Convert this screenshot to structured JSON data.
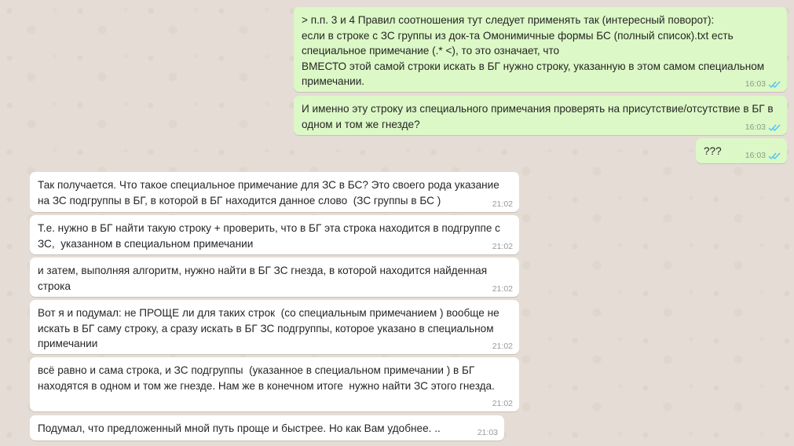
{
  "colors": {
    "background": "#e5ddd5",
    "outgoing_bubble": "#dcf8c6",
    "incoming_bubble": "#ffffff",
    "read_ticks": "#4fc3f7"
  },
  "messages": [
    {
      "direction": "out",
      "text": "> п.п. 3 и 4 Правил соотношения тут следует применять так (интересный поворот):\nесли в строке с ЗС группы из док-та Омонимичные формы БС (полный список).txt есть специальное примечание (.* <), то это означает, что\nВМЕСТО этой самой строки искать в БГ нужно строку, указанную в этом самом специальном примечании.",
      "time": "16:03",
      "status_icon": "double-check-read-icon"
    },
    {
      "direction": "out",
      "text": "И именно эту строку из специального примечания проверять на присутствие/отсутствие в БГ в одном и том же гнезде?",
      "time": "16:03",
      "status_icon": "double-check-read-icon"
    },
    {
      "direction": "out",
      "text": "???",
      "time": "16:03",
      "status_icon": "double-check-read-icon"
    },
    {
      "direction": "in",
      "text": "Так получается. Что такое специальное примечание для ЗС в БС? Это своего рода указание на ЗС подгруппы в БГ, в которой в БГ находится данное слово  (ЗС группы в БС )",
      "time": "21:02"
    },
    {
      "direction": "in",
      "text": "Т.е. нужно в БГ найти такую строку + проверить, что в БГ эта строка находится в подгруппе с ЗС,  указанном в специальном примечании",
      "time": "21:02"
    },
    {
      "direction": "in",
      "text": "и затем, выполняя алгоритм, нужно найти в БГ ЗС гнезда, в которой находится найденная строка",
      "time": "21:02"
    },
    {
      "direction": "in",
      "text": "Вот я и подумал: не ПРОЩЕ ли для таких строк  (со специальным примечанием ) вообще не искать в БГ саму строку, а сразу искать в БГ ЗС подгруппы, которое указано в специальном примечании",
      "time": "21:02"
    },
    {
      "direction": "in",
      "text": "всё равно и сама строка, и ЗС подгруппы  (указанное в специальном примечании ) в БГ находятся в одном и том же гнезде. Нам же в конечном итоге  нужно найти ЗС этого гнезда.",
      "time": "21:02"
    },
    {
      "direction": "in",
      "text": "Подумал, что предложенный мной путь проще и быстрее. Но как Вам удобнее. ..",
      "time": "21:03"
    }
  ]
}
